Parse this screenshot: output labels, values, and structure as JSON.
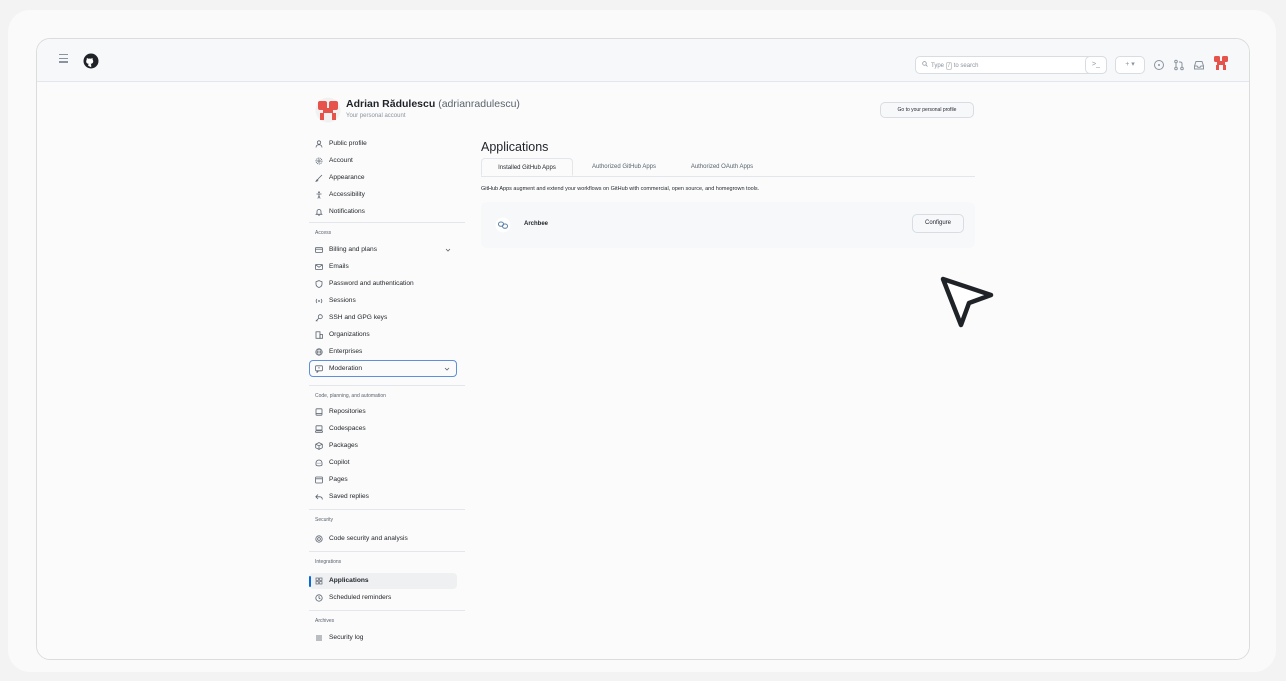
{
  "topbar": {
    "search_placeholder": "Type",
    "search_key": "/",
    "search_suffix": "to search",
    "terminal_label": ">_",
    "plus_label": "+ ▾"
  },
  "profile": {
    "name": "Adrian Rădulescu",
    "handle": "(adrianradulescu)",
    "subtitle": "Your personal account",
    "goto_button": "Go to your personal profile"
  },
  "sidebar": {
    "items": [
      {
        "label": "Public profile",
        "icon": "person-icon"
      },
      {
        "label": "Account",
        "icon": "gear-icon"
      },
      {
        "label": "Appearance",
        "icon": "paintbrush-icon"
      },
      {
        "label": "Accessibility",
        "icon": "accessibility-icon"
      },
      {
        "label": "Notifications",
        "icon": "bell-icon"
      }
    ],
    "access_heading": "Access",
    "access_items": [
      {
        "label": "Billing and plans",
        "icon": "credit-card-icon"
      },
      {
        "label": "Emails",
        "icon": "mail-icon"
      },
      {
        "label": "Password and authentication",
        "icon": "shield-lock-icon"
      },
      {
        "label": "Sessions",
        "icon": "broadcast-icon"
      },
      {
        "label": "SSH and GPG keys",
        "icon": "key-icon"
      },
      {
        "label": "Organizations",
        "icon": "organization-icon"
      },
      {
        "label": "Enterprises",
        "icon": "globe-icon"
      },
      {
        "label": "Moderation",
        "icon": "report-icon"
      }
    ],
    "code_heading": "Code, planning, and automation",
    "code_items": [
      {
        "label": "Repositories",
        "icon": "repo-icon"
      },
      {
        "label": "Codespaces",
        "icon": "codespaces-icon"
      },
      {
        "label": "Packages",
        "icon": "package-icon"
      },
      {
        "label": "Copilot",
        "icon": "copilot-icon"
      },
      {
        "label": "Pages",
        "icon": "browser-icon"
      },
      {
        "label": "Saved replies",
        "icon": "reply-icon"
      }
    ],
    "security_heading": "Security",
    "security_items": [
      {
        "label": "Code security and analysis",
        "icon": "codescan-icon"
      }
    ],
    "integrations_heading": "Integrations",
    "integrations_items": [
      {
        "label": "Applications",
        "icon": "apps-icon"
      },
      {
        "label": "Scheduled reminders",
        "icon": "clock-icon"
      }
    ],
    "archives_heading": "Archives",
    "archives_items": [
      {
        "label": "Security log",
        "icon": "log-icon"
      }
    ]
  },
  "main": {
    "title": "Applications",
    "tabs": [
      {
        "label": "Installed GitHub Apps"
      },
      {
        "label": "Authorized GitHub Apps"
      },
      {
        "label": "Authorized OAuth Apps"
      }
    ],
    "description": "GitHub Apps augment and extend your workflows on GitHub with commercial, open source, and homegrown tools.",
    "app": {
      "name": "Archbee",
      "button": "Configure"
    }
  },
  "colors": {
    "accent": "#0969da",
    "focus_border": "#5f8fd9",
    "avatar": "#e5534b"
  }
}
